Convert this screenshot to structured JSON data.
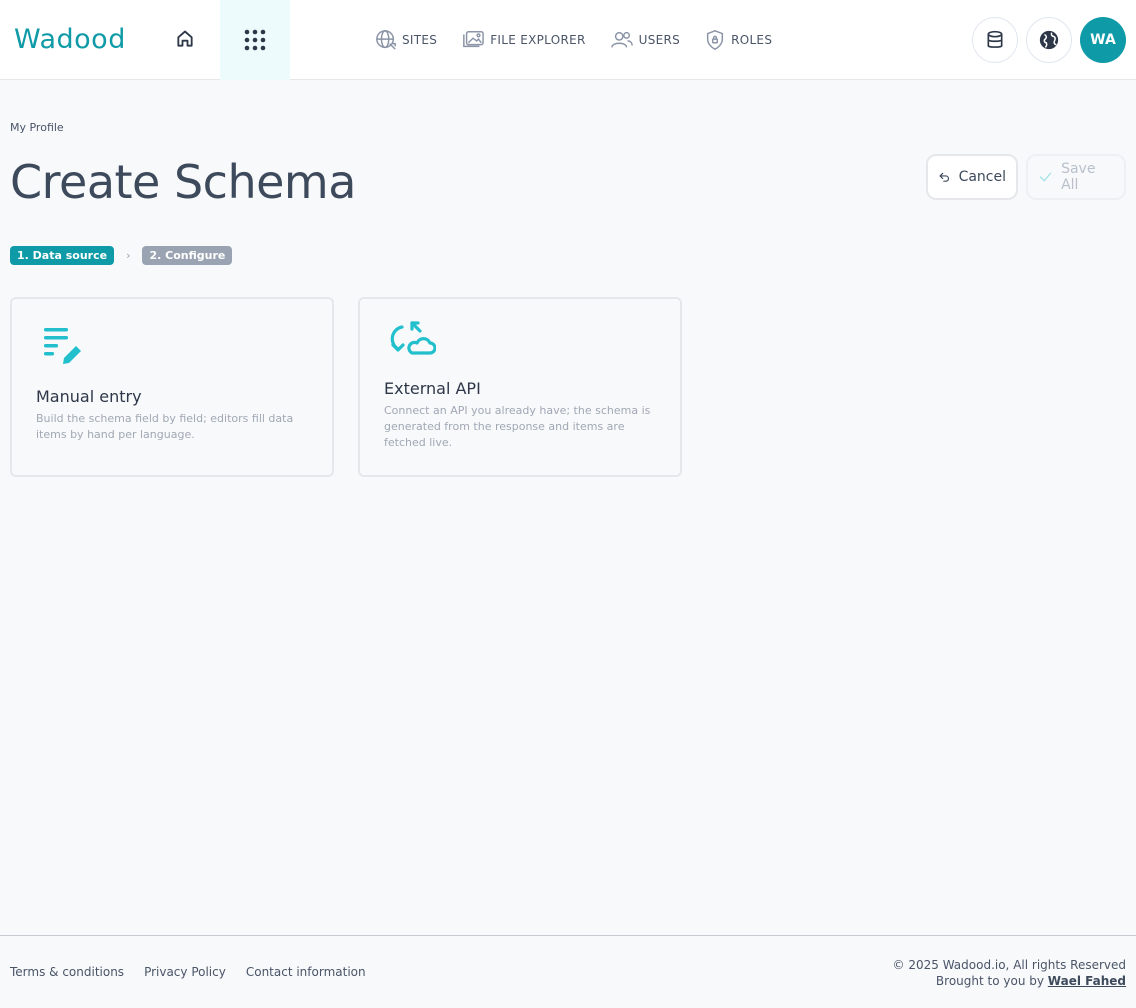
{
  "header": {
    "logo_text": "Wadood",
    "nav": [
      {
        "label": "SITES",
        "icon": "globe-icon"
      },
      {
        "label": "FILE EXPLORER",
        "icon": "folder-image-icon"
      },
      {
        "label": "USERS",
        "icon": "users-icon"
      },
      {
        "label": "ROLES",
        "icon": "shield-icon"
      }
    ],
    "avatar_initials": "WA"
  },
  "main": {
    "breadcrumb": "My Profile",
    "title": "Create Schema",
    "cancel_label": "Cancel",
    "save_label": "Save All",
    "steps": [
      {
        "label": "1. Data source",
        "active": true
      },
      {
        "label": "2. Configure",
        "active": false
      }
    ],
    "cards": [
      {
        "title": "Manual entry",
        "description": "Build the schema field by field; editors fill data items by hand per language.",
        "icon": "list-edit-icon"
      },
      {
        "title": "External API",
        "description": "Connect an API you already have; the schema is generated from the response and items are fetched live.",
        "icon": "cloud-sync-icon"
      }
    ]
  },
  "footer": {
    "links": [
      "Terms & conditions",
      "Privacy Policy",
      "Contact information"
    ],
    "copyright": "© 2025 Wadood.io, All rights Reserved",
    "brought_by": "Brought to you by",
    "author": "Wael Fahed"
  },
  "colors": {
    "accent": "#0e9aa7",
    "icon_teal": "#22c0cc",
    "background": "#f8f9fb"
  }
}
